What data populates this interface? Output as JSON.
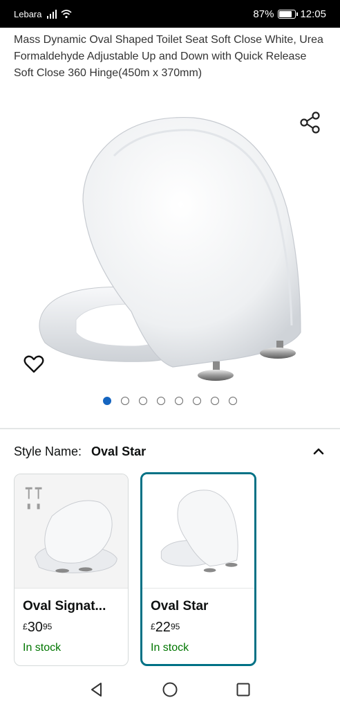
{
  "status_bar": {
    "carrier": "Lebara",
    "battery_percent": "87%",
    "battery_level": 0.87,
    "time": "12:05"
  },
  "product": {
    "title": "Mass Dynamic Oval Shaped Toilet Seat Soft Close White, Urea Formaldehyde Adjustable Up and Down with Quick Release Soft Close 360 Hinge(450m x 370mm)"
  },
  "icons": {
    "share": "share-icon",
    "wishlist": "heart-icon",
    "collapse": "chevron-up-icon",
    "nav_back": "triangle-back-icon",
    "nav_home": "circle-home-icon",
    "nav_recents": "square-recents-icon"
  },
  "carousel": {
    "total_images": 8,
    "active_index": 0
  },
  "style_selector": {
    "label": "Style Name:",
    "selected_value": "Oval Star",
    "options": [
      {
        "name": "Oval Signat...",
        "currency": "£",
        "price_whole": "30",
        "price_fraction": "95",
        "availability": "In stock",
        "selected": false
      },
      {
        "name": "Oval Star",
        "currency": "£",
        "price_whole": "22",
        "price_fraction": "95",
        "availability": "In stock",
        "selected": true
      }
    ]
  },
  "colors": {
    "accent_selected_border": "#007185",
    "in_stock": "#007600",
    "active_dot": "#1565c0"
  }
}
